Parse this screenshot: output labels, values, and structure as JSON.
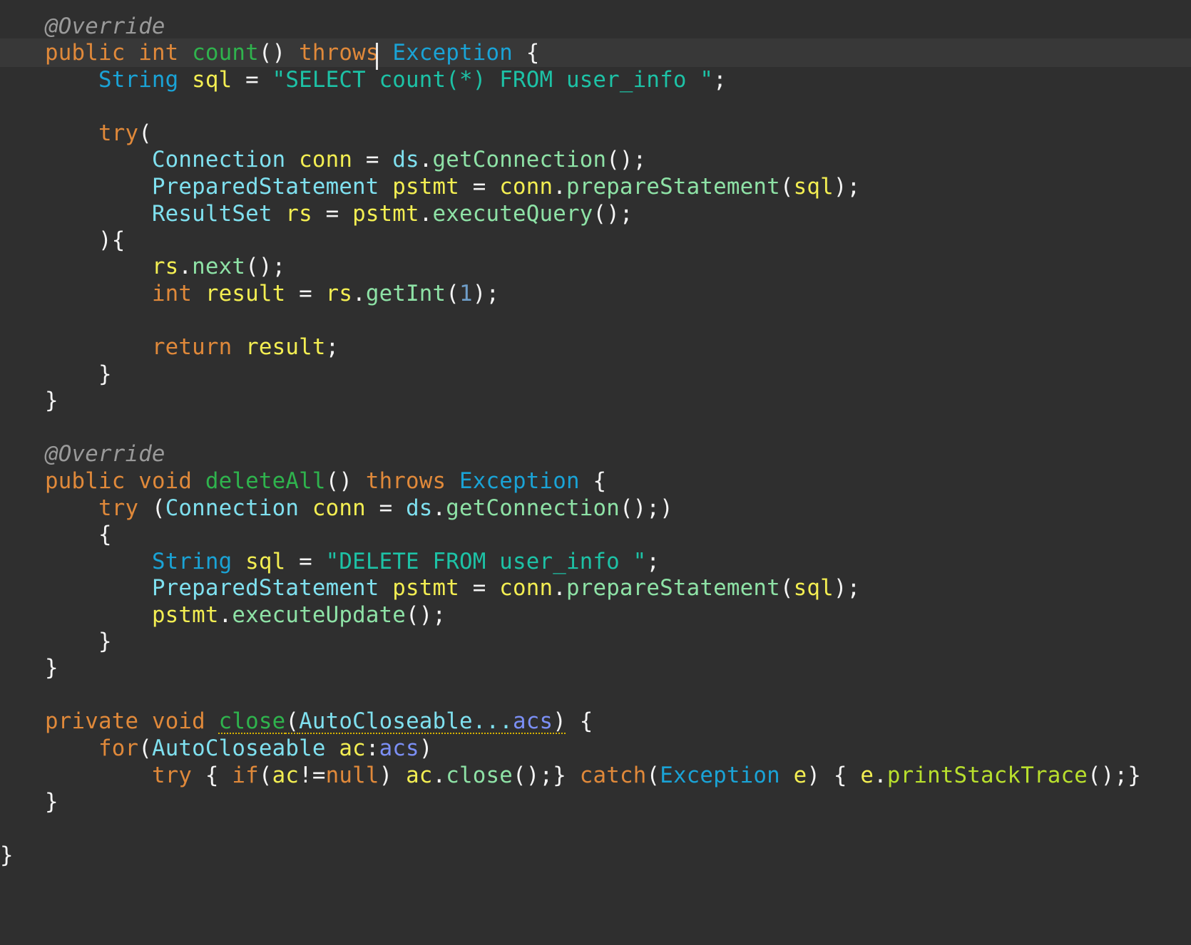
{
  "editor": {
    "code": {
      "lines": [
        [
          {
            "t": "@Override",
            "c": "ann"
          }
        ],
        [
          {
            "t": "public",
            "c": "kw"
          },
          {
            "t": " "
          },
          {
            "t": "int",
            "c": "kw"
          },
          {
            "t": " "
          },
          {
            "t": "count",
            "c": "mdecl"
          },
          {
            "t": "() "
          },
          {
            "t": "throws",
            "c": "kw"
          },
          {
            "t": " "
          },
          {
            "t": "Exception",
            "c": "type"
          },
          {
            "t": " {"
          }
        ],
        [
          {
            "t": "    "
          },
          {
            "t": "String",
            "c": "type"
          },
          {
            "t": " "
          },
          {
            "t": "sql",
            "c": "var"
          },
          {
            "t": " = "
          },
          {
            "t": "\"SELECT count(*) FROM user_info \"",
            "c": "str"
          },
          {
            "t": ";"
          }
        ],
        [],
        [
          {
            "t": "    "
          },
          {
            "t": "try",
            "c": "kw"
          },
          {
            "t": "("
          }
        ],
        [
          {
            "t": "        "
          },
          {
            "t": "Connection",
            "c": "type2"
          },
          {
            "t": " "
          },
          {
            "t": "conn",
            "c": "var"
          },
          {
            "t": " = "
          },
          {
            "t": "ds",
            "c": "type2"
          },
          {
            "t": "."
          },
          {
            "t": "getConnection",
            "c": "meth"
          },
          {
            "t": "();"
          }
        ],
        [
          {
            "t": "        "
          },
          {
            "t": "PreparedStatement",
            "c": "type2"
          },
          {
            "t": " "
          },
          {
            "t": "pstmt",
            "c": "var"
          },
          {
            "t": " = "
          },
          {
            "t": "conn",
            "c": "var"
          },
          {
            "t": "."
          },
          {
            "t": "prepareStatement",
            "c": "meth"
          },
          {
            "t": "("
          },
          {
            "t": "sql",
            "c": "var"
          },
          {
            "t": ");"
          }
        ],
        [
          {
            "t": "        "
          },
          {
            "t": "ResultSet",
            "c": "type2"
          },
          {
            "t": " "
          },
          {
            "t": "rs",
            "c": "var"
          },
          {
            "t": " = "
          },
          {
            "t": "pstmt",
            "c": "var"
          },
          {
            "t": "."
          },
          {
            "t": "executeQuery",
            "c": "meth"
          },
          {
            "t": "();"
          }
        ],
        [
          {
            "t": "    ){"
          }
        ],
        [
          {
            "t": "        "
          },
          {
            "t": "rs",
            "c": "var"
          },
          {
            "t": "."
          },
          {
            "t": "next",
            "c": "meth"
          },
          {
            "t": "();"
          }
        ],
        [
          {
            "t": "        "
          },
          {
            "t": "int",
            "c": "kw"
          },
          {
            "t": " "
          },
          {
            "t": "result",
            "c": "var"
          },
          {
            "t": " = "
          },
          {
            "t": "rs",
            "c": "var"
          },
          {
            "t": "."
          },
          {
            "t": "getInt",
            "c": "meth"
          },
          {
            "t": "("
          },
          {
            "t": "1",
            "c": "num"
          },
          {
            "t": ");"
          }
        ],
        [],
        [
          {
            "t": "        "
          },
          {
            "t": "return",
            "c": "kw"
          },
          {
            "t": " "
          },
          {
            "t": "result",
            "c": "var"
          },
          {
            "t": ";"
          }
        ],
        [
          {
            "t": "    }"
          }
        ],
        [
          {
            "t": "}"
          }
        ],
        [],
        [
          {
            "t": "@Override",
            "c": "ann"
          }
        ],
        [
          {
            "t": "public",
            "c": "kw"
          },
          {
            "t": " "
          },
          {
            "t": "void",
            "c": "kw"
          },
          {
            "t": " "
          },
          {
            "t": "deleteAll",
            "c": "mdecl"
          },
          {
            "t": "() "
          },
          {
            "t": "throws",
            "c": "kw"
          },
          {
            "t": " "
          },
          {
            "t": "Exception",
            "c": "type"
          },
          {
            "t": " {"
          }
        ],
        [
          {
            "t": "    "
          },
          {
            "t": "try",
            "c": "kw"
          },
          {
            "t": " ("
          },
          {
            "t": "Connection",
            "c": "type2"
          },
          {
            "t": " "
          },
          {
            "t": "conn",
            "c": "var"
          },
          {
            "t": " = "
          },
          {
            "t": "ds",
            "c": "type2"
          },
          {
            "t": "."
          },
          {
            "t": "getConnection",
            "c": "meth"
          },
          {
            "t": "();)"
          }
        ],
        [
          {
            "t": "    {"
          }
        ],
        [
          {
            "t": "        "
          },
          {
            "t": "String",
            "c": "type"
          },
          {
            "t": " "
          },
          {
            "t": "sql",
            "c": "var"
          },
          {
            "t": " = "
          },
          {
            "t": "\"DELETE FROM user_info \"",
            "c": "str"
          },
          {
            "t": ";"
          }
        ],
        [
          {
            "t": "        "
          },
          {
            "t": "PreparedStatement",
            "c": "type2"
          },
          {
            "t": " "
          },
          {
            "t": "pstmt",
            "c": "var"
          },
          {
            "t": " = "
          },
          {
            "t": "conn",
            "c": "var"
          },
          {
            "t": "."
          },
          {
            "t": "prepareStatement",
            "c": "meth"
          },
          {
            "t": "("
          },
          {
            "t": "sql",
            "c": "var"
          },
          {
            "t": ");"
          }
        ],
        [
          {
            "t": "        "
          },
          {
            "t": "pstmt",
            "c": "var"
          },
          {
            "t": "."
          },
          {
            "t": "executeUpdate",
            "c": "meth"
          },
          {
            "t": "();"
          }
        ],
        [
          {
            "t": "    }"
          }
        ],
        [
          {
            "t": "}"
          }
        ],
        [],
        [
          {
            "t": "private",
            "c": "kw"
          },
          {
            "t": " "
          },
          {
            "t": "void",
            "c": "kw"
          },
          {
            "t": " "
          },
          {
            "t": "close",
            "c": "mdecl warn"
          },
          {
            "t": "(",
            "c": "warn"
          },
          {
            "t": "AutoCloseable...",
            "c": "type2 warn"
          },
          {
            "t": "acs",
            "c": "param warn"
          },
          {
            "t": ")",
            "c": "warn"
          },
          {
            "t": " {"
          }
        ],
        [
          {
            "t": "    "
          },
          {
            "t": "for",
            "c": "kw"
          },
          {
            "t": "("
          },
          {
            "t": "AutoCloseable",
            "c": "type2"
          },
          {
            "t": " "
          },
          {
            "t": "ac",
            "c": "var"
          },
          {
            "t": ":"
          },
          {
            "t": "acs",
            "c": "param"
          },
          {
            "t": ")"
          }
        ],
        [
          {
            "t": "        "
          },
          {
            "t": "try",
            "c": "kw"
          },
          {
            "t": " { "
          },
          {
            "t": "if",
            "c": "kw"
          },
          {
            "t": "("
          },
          {
            "t": "ac",
            "c": "var"
          },
          {
            "t": "!="
          },
          {
            "t": "null",
            "c": "kw"
          },
          {
            "t": ") "
          },
          {
            "t": "ac",
            "c": "var"
          },
          {
            "t": "."
          },
          {
            "t": "close",
            "c": "meth"
          },
          {
            "t": "();} "
          },
          {
            "t": "catch",
            "c": "kw"
          },
          {
            "t": "("
          },
          {
            "t": "Exception",
            "c": "type"
          },
          {
            "t": " "
          },
          {
            "t": "e",
            "c": "var"
          },
          {
            "t": ") { "
          },
          {
            "t": "e",
            "c": "var"
          },
          {
            "t": "."
          },
          {
            "t": "printStackTrace",
            "c": "lime"
          },
          {
            "t": "();}"
          }
        ],
        [
          {
            "t": "}"
          }
        ],
        [],
        [
          {
            "t": "}"
          }
        ]
      ]
    }
  }
}
